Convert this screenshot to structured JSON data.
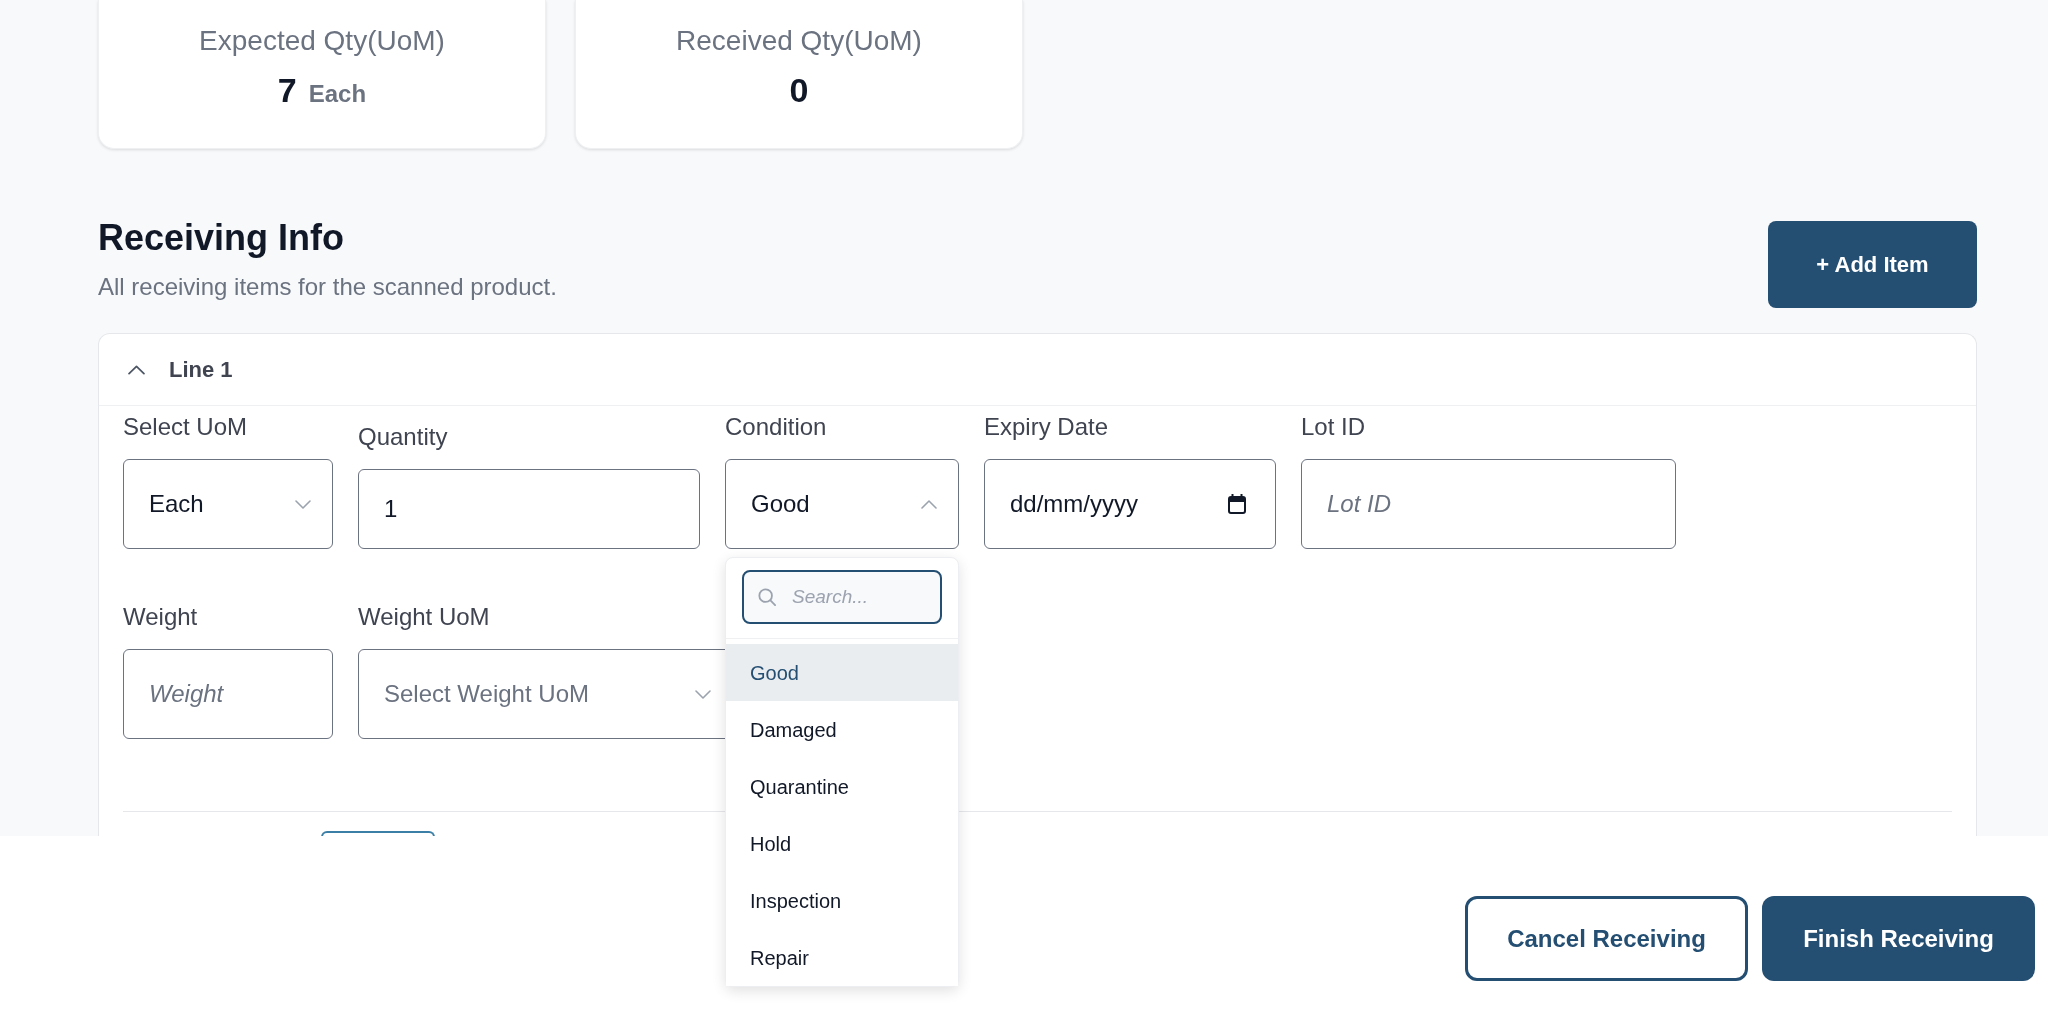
{
  "summary_cards": [
    {
      "title": "Expected Qty(UoM)",
      "value": "7",
      "unit": "Each"
    },
    {
      "title": "Received Qty(UoM)",
      "value": "0"
    }
  ],
  "section": {
    "title": "Receiving Info",
    "subtitle": "All receiving items for the scanned product.",
    "add_button": "+ Add Item"
  },
  "lines": [
    {
      "title": "Line 1",
      "expanded": true,
      "rows": [
        [
          {
            "kind": "select",
            "label": "Select UoM",
            "value": "Each",
            "open": false
          },
          {
            "kind": "number",
            "label": "Quantity",
            "value": "1"
          },
          {
            "kind": "select",
            "label": "Condition",
            "value": "Good",
            "open": true,
            "search_placeholder": "Search...",
            "options": [
              {
                "label": "Good",
                "selected": true
              },
              {
                "label": "Damaged",
                "selected": false
              },
              {
                "label": "Quarantine",
                "selected": false
              },
              {
                "label": "Hold",
                "selected": false
              },
              {
                "label": "Inspection",
                "selected": false
              },
              {
                "label": "Repair",
                "selected": false
              }
            ]
          },
          {
            "kind": "date",
            "label": "Expiry Date",
            "placeholder": "dd/mm/yyyy"
          },
          {
            "kind": "text",
            "label": "Lot ID",
            "placeholder": "Lot ID"
          }
        ],
        [
          {
            "kind": "text",
            "label": "Weight",
            "placeholder": "Weight"
          },
          {
            "kind": "select",
            "label": "Weight UoM",
            "placeholder": "Select Weight UoM",
            "open": false
          }
        ]
      ]
    }
  ],
  "footer": {
    "buttons": [
      {
        "label": "Cancel Receiving",
        "kind": "secondary"
      },
      {
        "label": "Finish Receiving",
        "kind": "primary"
      }
    ]
  }
}
